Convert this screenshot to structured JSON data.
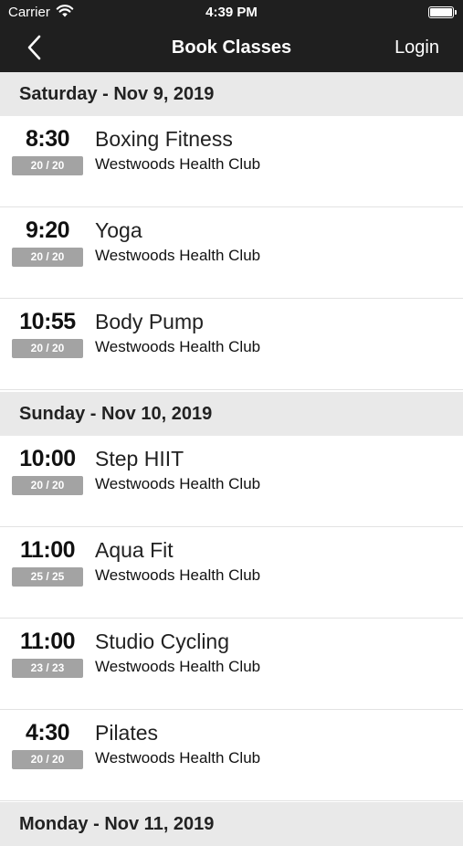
{
  "status": {
    "carrier": "Carrier",
    "time": "4:39 PM"
  },
  "nav": {
    "title": "Book Classes",
    "login_label": "Login"
  },
  "days": [
    {
      "date": "Saturday - Nov 9, 2019",
      "classes": [
        {
          "time": "8:30",
          "spots": "20 / 20",
          "name": "Boxing Fitness",
          "club": "Westwoods Health Club"
        },
        {
          "time": "9:20",
          "spots": "20 / 20",
          "name": "Yoga",
          "club": "Westwoods Health Club"
        },
        {
          "time": "10:55",
          "spots": "20 / 20",
          "name": "Body Pump",
          "club": "Westwoods Health Club"
        }
      ]
    },
    {
      "date": "Sunday - Nov 10, 2019",
      "classes": [
        {
          "time": "10:00",
          "spots": "20 / 20",
          "name": "Step HIIT",
          "club": "Westwoods Health Club"
        },
        {
          "time": "11:00",
          "spots": "25 / 25",
          "name": "Aqua Fit",
          "club": "Westwoods Health Club"
        },
        {
          "time": "11:00",
          "spots": "23 / 23",
          "name": "Studio Cycling",
          "club": "Westwoods Health Club"
        },
        {
          "time": "4:30",
          "spots": "20 / 20",
          "name": "Pilates",
          "club": "Westwoods Health Club"
        }
      ]
    },
    {
      "date": "Monday - Nov 11, 2019",
      "classes": []
    }
  ]
}
